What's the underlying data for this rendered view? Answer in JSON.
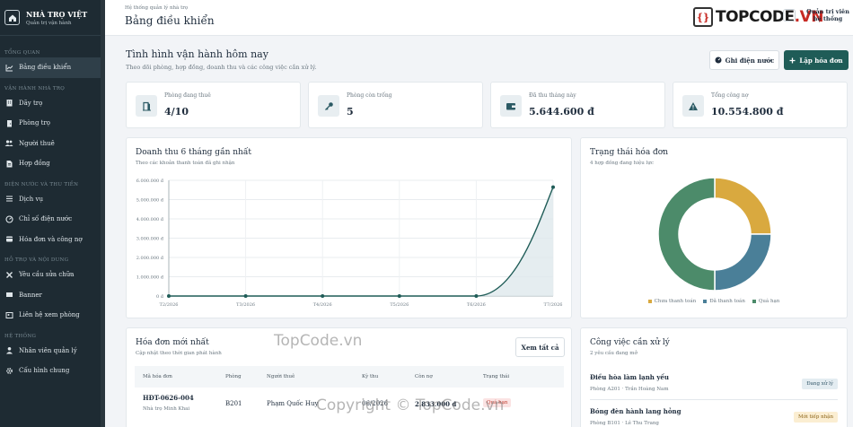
{
  "sidebar": {
    "brand_title": "NHÀ TRỌ VIỆT",
    "brand_subtitle": "Quản trị vận hành",
    "sections": [
      {
        "label": "Tổng quan",
        "items": [
          {
            "label": "Bảng điều khiển",
            "icon": "chart-icon",
            "active": true
          }
        ]
      },
      {
        "label": "Vận hành nhà trọ",
        "items": [
          {
            "label": "Dãy trọ",
            "icon": "building-icon"
          },
          {
            "label": "Phòng trọ",
            "icon": "door-icon"
          },
          {
            "label": "Người thuê",
            "icon": "users-icon"
          },
          {
            "label": "Hợp đồng",
            "icon": "contract-icon"
          }
        ]
      },
      {
        "label": "Điện nước và thu tiền",
        "items": [
          {
            "label": "Dịch vụ",
            "icon": "list-icon"
          },
          {
            "label": "Chỉ số điện nước",
            "icon": "gauge-icon"
          },
          {
            "label": "Hóa đơn và công nợ",
            "icon": "invoice-icon"
          }
        ]
      },
      {
        "label": "Hỗ trợ và nội dung",
        "items": [
          {
            "label": "Yêu cầu sửa chữa",
            "icon": "tools-icon"
          },
          {
            "label": "Banner",
            "icon": "banner-icon"
          },
          {
            "label": "Liên hệ xem phòng",
            "icon": "contact-icon"
          }
        ]
      },
      {
        "label": "Hệ thống",
        "items": [
          {
            "label": "Nhân viên quản lý",
            "icon": "user-icon"
          },
          {
            "label": "Cấu hình chung",
            "icon": "gear-icon"
          }
        ]
      }
    ]
  },
  "topbar": {
    "breadcrumb": "Hệ thống quản lý nhà trọ",
    "title": "Bảng điều khiển",
    "logo_text_a": "TOPCODE",
    "logo_text_b": ".VN",
    "admin_label": "Quản trị viên hệ thống"
  },
  "header": {
    "title": "Tình hình vận hành hôm nay",
    "subtitle": "Theo dõi phòng, hợp đồng, doanh thu và các công việc cần xử lý.",
    "meter_button": "Ghi điện nước",
    "add_invoice_button": "Lập hóa đơn"
  },
  "stats": [
    {
      "label": "Phòng đang thuê",
      "value": "4/10",
      "icon": "door-icon"
    },
    {
      "label": "Phòng còn trống",
      "value": "5",
      "icon": "key-icon"
    },
    {
      "label": "Đã thu tháng này",
      "value": "5.644.600 đ",
      "icon": "wallet-icon"
    },
    {
      "label": "Tổng công nợ",
      "value": "10.554.800 đ",
      "icon": "warning-icon"
    }
  ],
  "revenue": {
    "title": "Doanh thu 6 tháng gần nhất",
    "subtitle": "Theo các khoản thanh toán đã ghi nhận"
  },
  "invoice_status": {
    "title": "Trạng thái hóa đơn",
    "subtitle": "4 hợp đồng đang hiệu lực"
  },
  "chart_data": [
    {
      "type": "area",
      "title": "Doanh thu 6 tháng gần nhất",
      "x": [
        "T2/2026",
        "T3/2026",
        "T4/2026",
        "T5/2026",
        "T6/2026",
        "T7/2026"
      ],
      "y": [
        0,
        0,
        0,
        0,
        0,
        5644600
      ],
      "ylim": [
        0,
        6000000
      ],
      "yticks": [
        "0 đ",
        "1.000.000 đ",
        "2.000.000 đ",
        "3.000.000 đ",
        "4.000.000 đ",
        "5.000.000 đ",
        "6.000.000 đ"
      ],
      "grid": true,
      "color": "#1f5c57"
    },
    {
      "type": "pie",
      "donut": true,
      "labels": [
        "Chưa thanh toán",
        "Đã thanh toán",
        "Quá hạn"
      ],
      "values": [
        1,
        1,
        2
      ],
      "colors": [
        "#d9a93f",
        "#4a7f98",
        "#4c8b6a"
      ],
      "legend": "bottom"
    }
  ],
  "invoices": {
    "title": "Hóa đơn mới nhất",
    "subtitle": "Cập nhật theo thời gian phát hành",
    "view_all": "Xem tất cả",
    "columns": [
      "Mã hóa đơn",
      "Phòng",
      "Người thuê",
      "Kỳ thu",
      "Còn nợ",
      "Trạng thái"
    ],
    "rows": [
      {
        "code": "HĐT-0626-004",
        "building": "Nhà trọ Minh Khai",
        "room": "B201",
        "tenant": "Phạm Quốc Huy",
        "period": "06/2026",
        "debt": "2.833.000 đ",
        "status": "Quá hạn"
      }
    ]
  },
  "tasks": {
    "title": "Công việc cần xử lý",
    "subtitle": "2 yêu cầu đang mở",
    "items": [
      {
        "title": "Điều hòa làm lạnh yếu",
        "meta": "Phòng A201 · Trần Hoàng Nam",
        "status": "Đang xử lý"
      },
      {
        "title": "Bóng đèn hành lang hỏng",
        "meta": "Phòng B101 · Lê Thu Trang",
        "status": "Mới tiếp nhận"
      }
    ]
  },
  "watermarks": [
    "TopCode.vn",
    "Copyright © TopCode.vn"
  ]
}
